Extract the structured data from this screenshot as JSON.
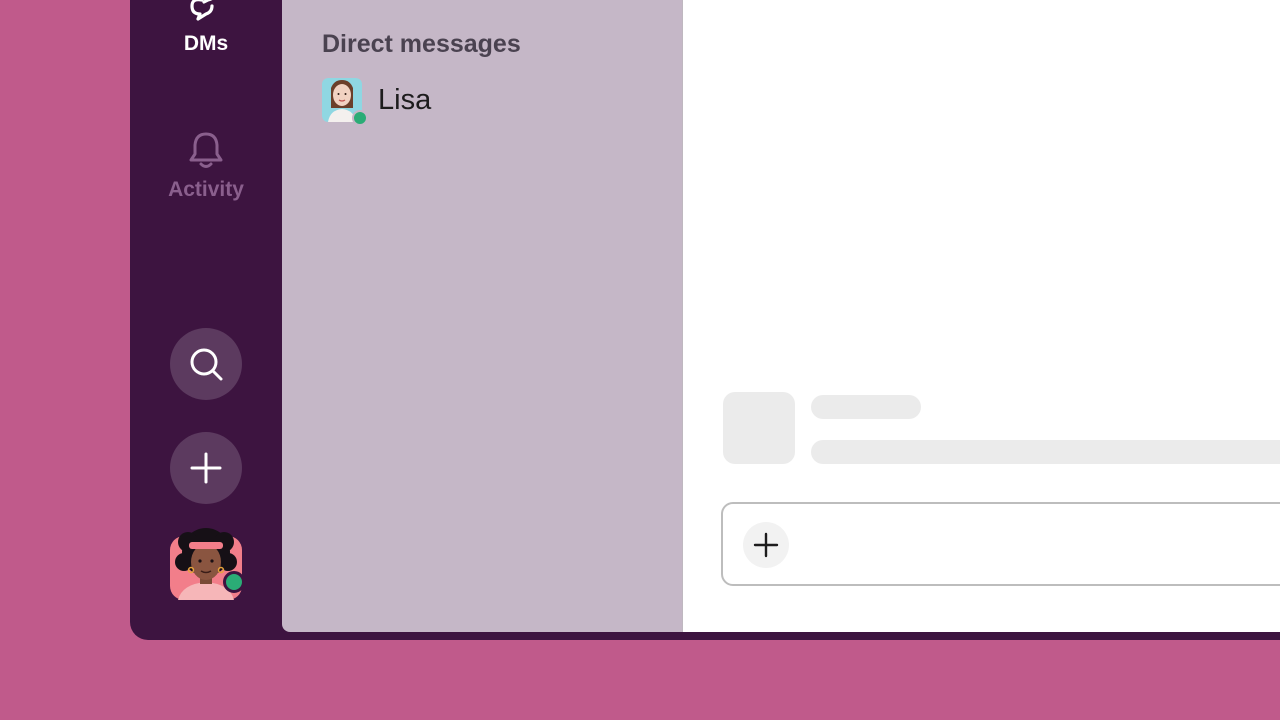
{
  "rail": {
    "dms_label": "DMs",
    "activity_label": "Activity",
    "icons": [
      "dms-icon",
      "bell-icon",
      "search-icon",
      "plus-icon"
    ],
    "user_presence": "active"
  },
  "sidebar": {
    "section_title": "Direct messages",
    "dms": [
      {
        "name": "Lisa",
        "presence": "active"
      }
    ]
  },
  "main": {
    "composer_icon": "plus-icon"
  },
  "colors": {
    "background": "#c05a8b",
    "rail": "#3d1440",
    "sidebar": "#c5b7c7",
    "presence": "#2bac76"
  }
}
